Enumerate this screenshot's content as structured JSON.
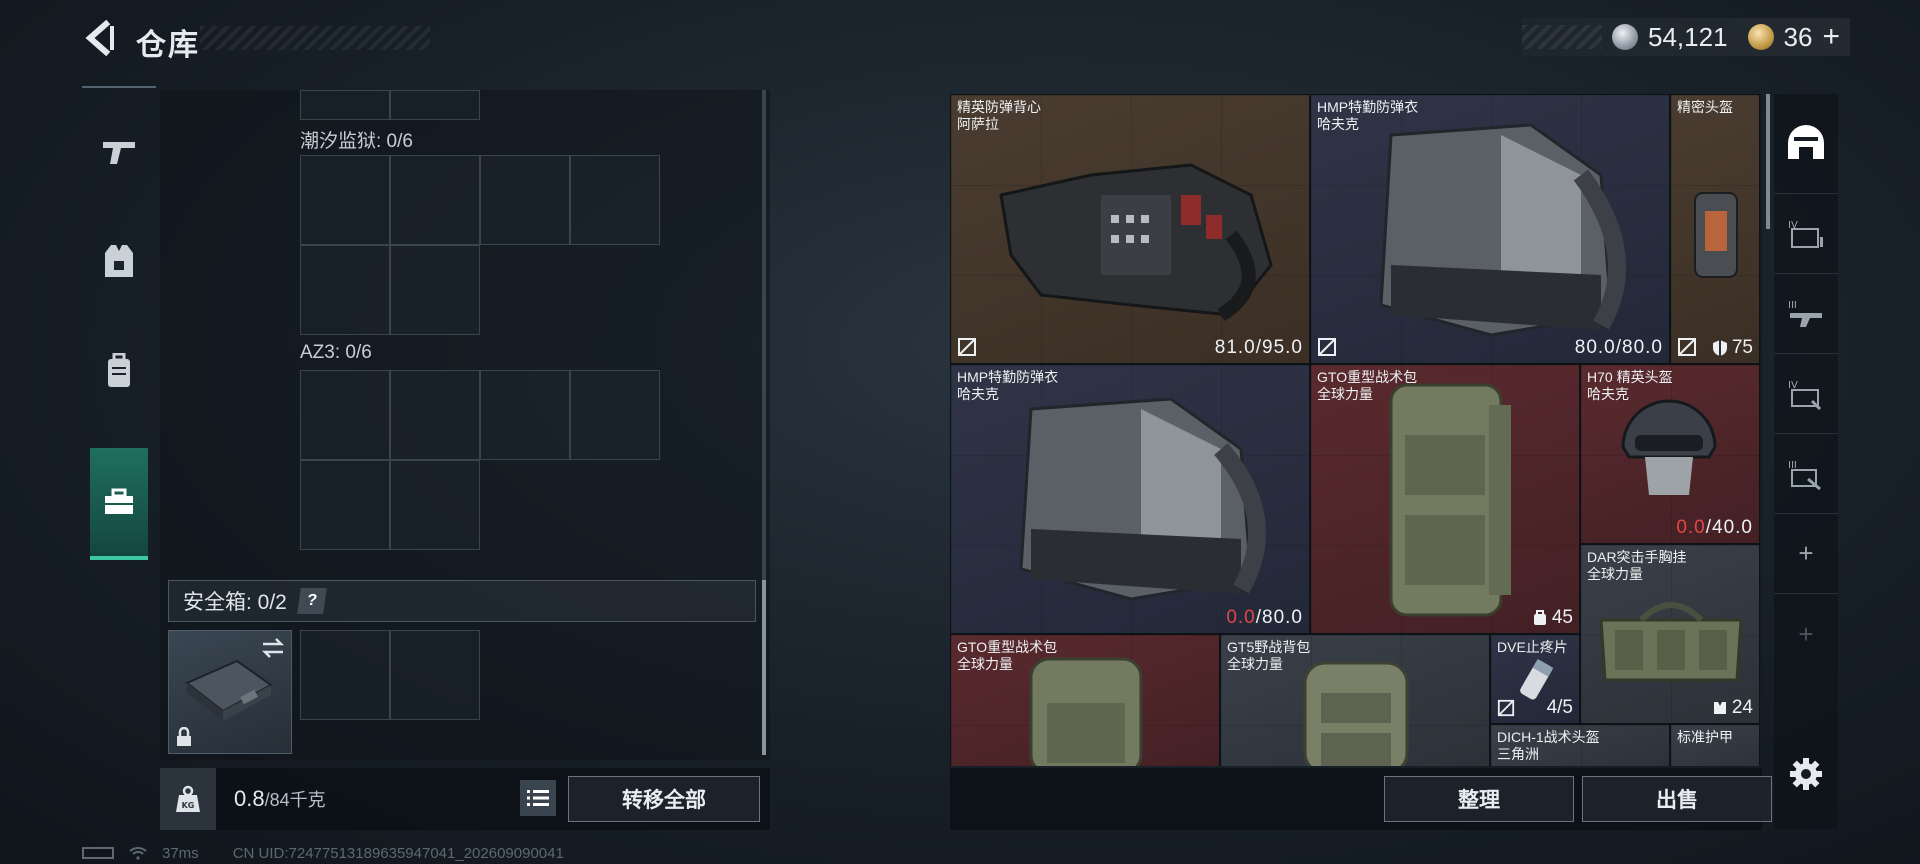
{
  "header": {
    "title": "仓库",
    "currency_silver": "54,121",
    "currency_gold": "36"
  },
  "left": {
    "grid1_label": "潮汐监狱: 0/6",
    "grid2_label": "AZ3: 0/6",
    "safe_label": "安全箱: 0/2",
    "help_label": "?",
    "weight_value": "0.8",
    "weight_max": "/84千克",
    "transfer_label": "转移全部"
  },
  "items": [
    {
      "name": "精英防弹背心",
      "sub": "阿萨拉",
      "durability": "81.0/95.0",
      "color": "brown"
    },
    {
      "name": "HMP特勤防弹衣",
      "sub": "哈夫克",
      "durability": "80.0/80.0",
      "color": "blue"
    },
    {
      "name": "精密头盔",
      "sub": "",
      "stat": "75",
      "color": "brown"
    },
    {
      "name": "HMP特勤防弹衣",
      "sub": "哈夫克",
      "durability_low": "0.0",
      "durability_max": "/80.0",
      "color": "blue"
    },
    {
      "name": "GTO重型战术包",
      "sub": "全球力量",
      "stat": "45",
      "color": "red"
    },
    {
      "name": "H70 精英头盔",
      "sub": "哈夫克",
      "durability_low": "0.0",
      "durability_max": "/40.0",
      "color": "red"
    },
    {
      "name": "DAR突击手胸挂",
      "sub": "全球力量",
      "stat": "24",
      "color": "grey"
    },
    {
      "name": "GTO重型战术包",
      "sub": "全球力量",
      "color": "red"
    },
    {
      "name": "GT5野战背包",
      "sub": "全球力量",
      "color": "grey"
    },
    {
      "name": "DVE止疼片",
      "sub": "",
      "stat": "4/5",
      "color": "blue"
    },
    {
      "name": "DICH-1战术头盔",
      "sub": "三角洲",
      "color": "grey"
    },
    {
      "name": "标准护甲",
      "sub": "",
      "color": "grey"
    }
  ],
  "actions": {
    "organize_label": "整理",
    "sell_label": "出售"
  },
  "status": {
    "ping": "37ms",
    "uid": "CN UID:7247751318963594704​1_202609090041"
  },
  "colors": {
    "accent_teal": "#3fc6a3",
    "low_durability": "#e24646"
  }
}
